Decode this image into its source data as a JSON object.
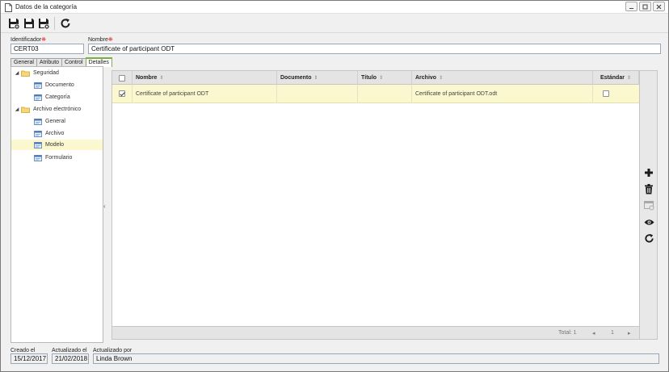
{
  "window": {
    "title": "Datos de la categoría"
  },
  "toolbar": {
    "buttons": [
      {
        "icon": "save-new-icon"
      },
      {
        "icon": "save-icon"
      },
      {
        "icon": "save-close-icon"
      },
      {
        "icon": "refresh-icon"
      }
    ]
  },
  "form": {
    "identifier_label": "Identificador",
    "identifier_value": "CERT03",
    "name_label": "Nombre",
    "name_value": "Certificate of participant ODT",
    "required_mark": "❋"
  },
  "tabs": [
    {
      "label": "General",
      "active": false
    },
    {
      "label": "Atributo",
      "active": false
    },
    {
      "label": "Control",
      "active": false
    },
    {
      "label": "Detalles",
      "active": true
    }
  ],
  "tree": {
    "groups": [
      {
        "label": "Seguridad",
        "children": [
          "Documento",
          "Categoría"
        ]
      },
      {
        "label": "Archivo electrónico",
        "children": [
          "General",
          "Archivo",
          "Modelo",
          "Formulario"
        ]
      }
    ],
    "selected": "Modelo"
  },
  "grid": {
    "columns": [
      "Nombre",
      "Documento",
      "Título",
      "Archivo",
      "Estándar"
    ],
    "rows": [
      {
        "checked": true,
        "nombre": "Certificate of participant ODT",
        "documento": "",
        "titulo": "",
        "archivo": "Certificate of participant ODT.odt",
        "estandar": false
      }
    ],
    "footer": {
      "total_label": "Total: 1",
      "page": "1"
    }
  },
  "side_actions": [
    "add-icon",
    "delete-icon",
    "template-icon",
    "view-icon",
    "refresh-icon"
  ],
  "audit": {
    "created_label": "Creado el",
    "created_value": "15/12/2017",
    "updated_label": "Actualizado el",
    "updated_value": "21/02/2018",
    "updated_by_label": "Actualizado por",
    "updated_by_value": "Linda Brown"
  }
}
